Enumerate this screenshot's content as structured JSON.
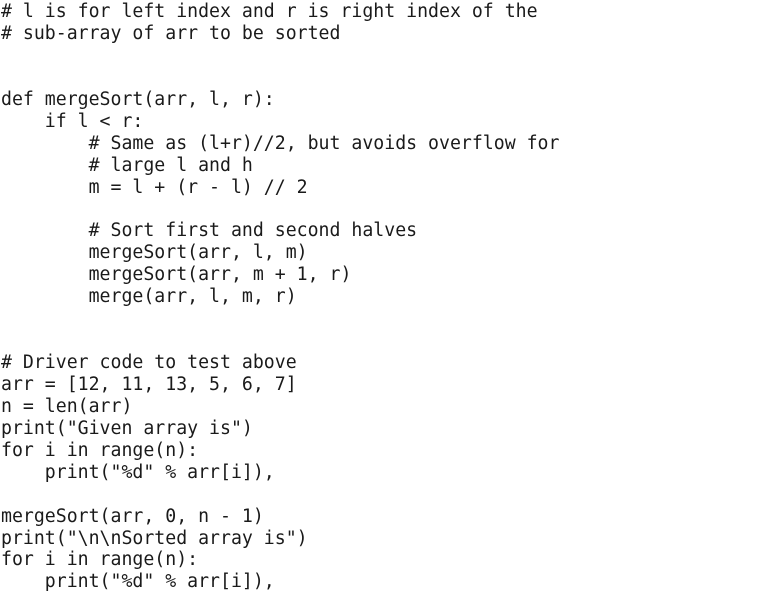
{
  "editor": {
    "lines": [
      "# l is for left index and r is right index of the",
      "# sub-array of arr to be sorted",
      "",
      "",
      "def mergeSort(arr, l, r):",
      "    if l < r:",
      "        # Same as (l+r)//2, but avoids overflow for",
      "        # large l and h",
      "        m = l + (r - l) // 2",
      "",
      "        # Sort first and second halves",
      "        mergeSort(arr, l, m)",
      "        mergeSort(arr, m + 1, r)",
      "        merge(arr, l, m, r)",
      "",
      "",
      "# Driver code to test above",
      "arr = [12, 11, 13, 5, 6, 7]",
      "n = len(arr)",
      "print(\"Given array is\")",
      "for i in range(n):",
      "    print(\"%d\" % arr[i]),",
      "",
      "mergeSort(arr, 0, n - 1)",
      "print(\"\\n\\nSorted array is\")",
      "for i in range(n):",
      "    print(\"%d\" % arr[i]),"
    ]
  }
}
